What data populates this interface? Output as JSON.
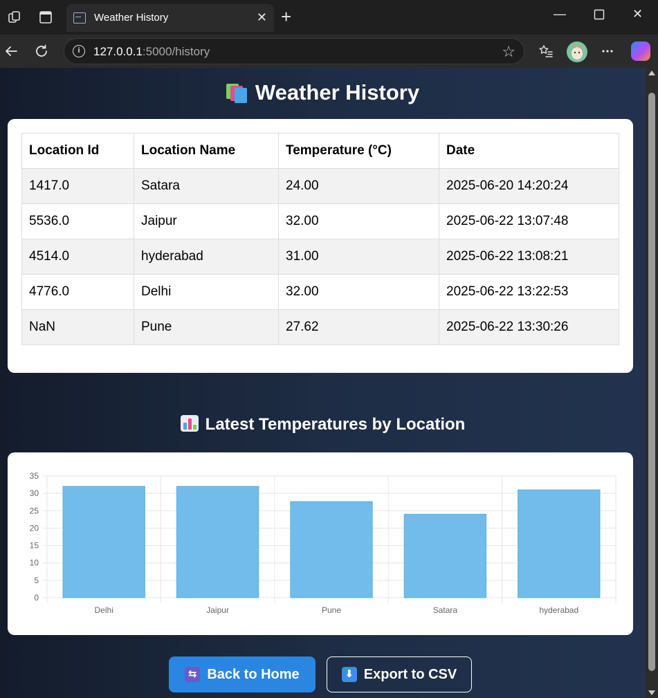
{
  "browser": {
    "tab_title": "Weather History",
    "url_host": "127.0.0.1",
    "url_rest": ":5000/history"
  },
  "page": {
    "title": "Weather History",
    "table": {
      "headers": [
        "Location Id",
        "Location Name",
        "Temperature (°C)",
        "Date"
      ],
      "rows": [
        [
          "1417.0",
          "Satara",
          "24.00",
          "2025-06-20 14:20:24"
        ],
        [
          "5536.0",
          "Jaipur",
          "32.00",
          "2025-06-22 13:07:48"
        ],
        [
          "4514.0",
          "hyderabad",
          "31.00",
          "2025-06-22 13:08:21"
        ],
        [
          "4776.0",
          "Delhi",
          "32.00",
          "2025-06-22 13:22:53"
        ],
        [
          "NaN",
          "Pune",
          "27.62",
          "2025-06-22 13:30:26"
        ]
      ]
    },
    "chart_heading": "Latest Temperatures by Location",
    "buttons": {
      "home": "Back to Home",
      "export": "Export to CSV"
    }
  },
  "chart_data": {
    "type": "bar",
    "categories": [
      "Delhi",
      "Jaipur",
      "Pune",
      "Satara",
      "hyderabad"
    ],
    "values": [
      32,
      32,
      27.62,
      24,
      31
    ],
    "ylim": [
      0,
      35
    ],
    "yticks": [
      0,
      5,
      10,
      15,
      20,
      25,
      30,
      35
    ],
    "grid": true,
    "bar_color": "#72bcec",
    "bar_border": "#5aaee6"
  },
  "colors": {
    "primary_button": "#2a86e0",
    "row_stripe": "#f2f2f2"
  }
}
